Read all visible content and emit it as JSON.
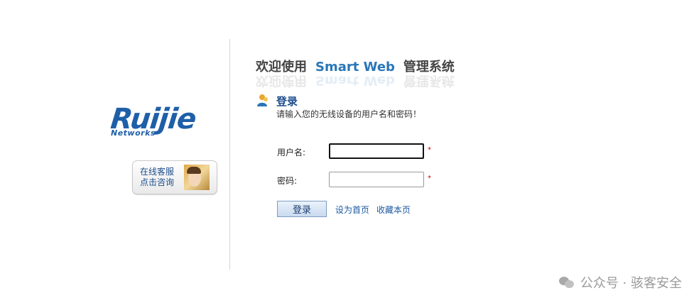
{
  "brand": {
    "name": "Ruijie",
    "subtitle": "Networks"
  },
  "support_button": {
    "line1": "在线客服",
    "line2": "点击咨询"
  },
  "title": {
    "part1": "欢迎使用",
    "part2": "Smart  Web",
    "part3": "管理系统"
  },
  "login": {
    "heading": "登录",
    "description": "请输入您的无线设备的用户名和密码！",
    "username_label": "用户名:",
    "password_label": "密码:",
    "username_value": "",
    "password_value": "",
    "required_mark": "*",
    "submit_label": "登录",
    "set_home_link": "设为首页",
    "bookmark_link": "收藏本页"
  },
  "watermark": {
    "text": "公众号 · 骇客安全"
  },
  "colors": {
    "accent": "#2a76b8",
    "brand": "#1f5fa8",
    "required": "#d00000"
  }
}
